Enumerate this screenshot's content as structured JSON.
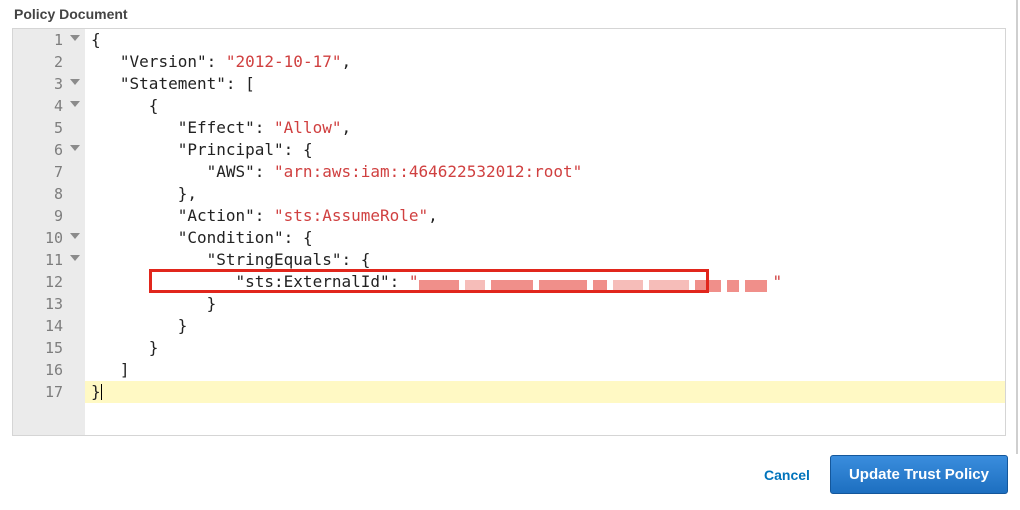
{
  "header": {
    "title": "Policy Document"
  },
  "editor": {
    "highlighted_line": 17,
    "lines": [
      {
        "n": 1,
        "fold": true,
        "indent": 0,
        "tokens": [
          {
            "t": "punc",
            "v": "{"
          }
        ]
      },
      {
        "n": 2,
        "fold": false,
        "indent": 1,
        "tokens": [
          {
            "t": "key",
            "v": "\"Version\""
          },
          {
            "t": "punc",
            "v": ": "
          },
          {
            "t": "str",
            "v": "\"2012-10-17\""
          },
          {
            "t": "punc",
            "v": ","
          }
        ]
      },
      {
        "n": 3,
        "fold": true,
        "indent": 1,
        "tokens": [
          {
            "t": "key",
            "v": "\"Statement\""
          },
          {
            "t": "punc",
            "v": ": ["
          }
        ]
      },
      {
        "n": 4,
        "fold": true,
        "indent": 2,
        "tokens": [
          {
            "t": "punc",
            "v": "{"
          }
        ]
      },
      {
        "n": 5,
        "fold": false,
        "indent": 3,
        "tokens": [
          {
            "t": "key",
            "v": "\"Effect\""
          },
          {
            "t": "punc",
            "v": ": "
          },
          {
            "t": "str",
            "v": "\"Allow\""
          },
          {
            "t": "punc",
            "v": ","
          }
        ]
      },
      {
        "n": 6,
        "fold": true,
        "indent": 3,
        "tokens": [
          {
            "t": "key",
            "v": "\"Principal\""
          },
          {
            "t": "punc",
            "v": ": {"
          }
        ]
      },
      {
        "n": 7,
        "fold": false,
        "indent": 4,
        "tokens": [
          {
            "t": "key",
            "v": "\"AWS\""
          },
          {
            "t": "punc",
            "v": ": "
          },
          {
            "t": "str",
            "v": "\"arn:aws:iam::464622532012:root\""
          }
        ]
      },
      {
        "n": 8,
        "fold": false,
        "indent": 3,
        "tokens": [
          {
            "t": "punc",
            "v": "},"
          }
        ]
      },
      {
        "n": 9,
        "fold": false,
        "indent": 3,
        "tokens": [
          {
            "t": "key",
            "v": "\"Action\""
          },
          {
            "t": "punc",
            "v": ": "
          },
          {
            "t": "str",
            "v": "\"sts:AssumeRole\""
          },
          {
            "t": "punc",
            "v": ","
          }
        ]
      },
      {
        "n": 10,
        "fold": true,
        "indent": 3,
        "tokens": [
          {
            "t": "key",
            "v": "\"Condition\""
          },
          {
            "t": "punc",
            "v": ": {"
          }
        ]
      },
      {
        "n": 11,
        "fold": true,
        "indent": 4,
        "tokens": [
          {
            "t": "key",
            "v": "\"StringEquals\""
          },
          {
            "t": "punc",
            "v": ": {"
          }
        ]
      },
      {
        "n": 12,
        "fold": false,
        "indent": 5,
        "tokens": [
          {
            "t": "key",
            "v": "\"sts:ExternalId\""
          },
          {
            "t": "punc",
            "v": ": "
          },
          {
            "t": "str",
            "v": "\""
          },
          {
            "t": "redact",
            "v": ""
          },
          {
            "t": "str",
            "v": "\""
          }
        ]
      },
      {
        "n": 13,
        "fold": false,
        "indent": 4,
        "tokens": [
          {
            "t": "punc",
            "v": "}"
          }
        ]
      },
      {
        "n": 14,
        "fold": false,
        "indent": 3,
        "tokens": [
          {
            "t": "punc",
            "v": "}"
          }
        ]
      },
      {
        "n": 15,
        "fold": false,
        "indent": 2,
        "tokens": [
          {
            "t": "punc",
            "v": "}"
          }
        ]
      },
      {
        "n": 16,
        "fold": false,
        "indent": 1,
        "tokens": [
          {
            "t": "punc",
            "v": "]"
          }
        ]
      },
      {
        "n": 17,
        "fold": false,
        "indent": 0,
        "tokens": [
          {
            "t": "punc",
            "v": "}"
          }
        ]
      }
    ],
    "annotation_box": {
      "line": 12
    },
    "json_value": {
      "Version": "2012-10-17",
      "Statement": [
        {
          "Effect": "Allow",
          "Principal": {
            "AWS": "arn:aws:iam::464622532012:root"
          },
          "Action": "sts:AssumeRole",
          "Condition": {
            "StringEquals": {
              "sts:ExternalId": "[REDACTED]"
            }
          }
        }
      ]
    }
  },
  "footer": {
    "cancel_label": "Cancel",
    "submit_label": "Update Trust Policy"
  }
}
